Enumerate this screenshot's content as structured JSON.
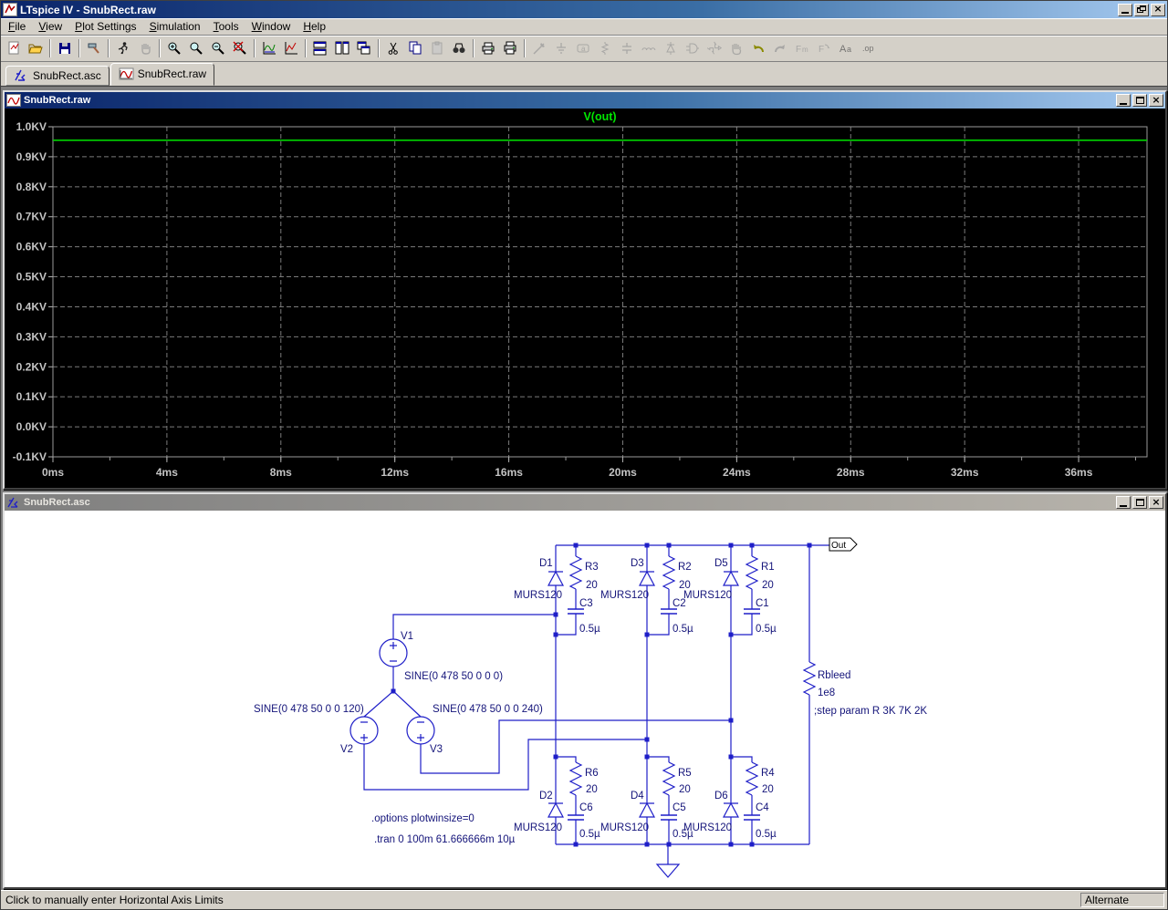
{
  "window": {
    "title": "LTspice IV - SnubRect.raw"
  },
  "menu": {
    "items": [
      "File",
      "View",
      "Plot Settings",
      "Simulation",
      "Tools",
      "Window",
      "Help"
    ]
  },
  "toolbar": {
    "buttons": [
      {
        "name": "new-schematic",
        "disabled": false
      },
      {
        "name": "open-file",
        "disabled": false
      },
      {
        "name": "save",
        "disabled": false
      },
      {
        "name": "control-panel",
        "disabled": false
      },
      {
        "name": "run-simulation",
        "disabled": false
      },
      {
        "name": "halt-simulation",
        "disabled": true
      },
      {
        "name": "zoom-in",
        "disabled": false
      },
      {
        "name": "zoom-to-rectangle",
        "disabled": false
      },
      {
        "name": "zoom-out",
        "disabled": false
      },
      {
        "name": "zoom-full-extents",
        "disabled": false
      },
      {
        "name": "autorange-y-axis",
        "disabled": false
      },
      {
        "name": "plot-settings",
        "disabled": false
      },
      {
        "name": "tile-horizontally",
        "disabled": false
      },
      {
        "name": "tile-vertically",
        "disabled": false
      },
      {
        "name": "cascade-windows",
        "disabled": false
      },
      {
        "name": "cut",
        "disabled": false
      },
      {
        "name": "copy",
        "disabled": false
      },
      {
        "name": "paste",
        "disabled": true
      },
      {
        "name": "find",
        "disabled": false
      },
      {
        "name": "print-preview",
        "disabled": false
      },
      {
        "name": "print",
        "disabled": false
      },
      {
        "name": "draw-wire",
        "disabled": true
      },
      {
        "name": "place-ground",
        "disabled": true
      },
      {
        "name": "place-label",
        "disabled": true
      },
      {
        "name": "place-resistor",
        "disabled": true
      },
      {
        "name": "place-capacitor",
        "disabled": true
      },
      {
        "name": "place-inductor",
        "disabled": true
      },
      {
        "name": "place-diode",
        "disabled": true
      },
      {
        "name": "place-component",
        "disabled": true
      },
      {
        "name": "move",
        "disabled": true
      },
      {
        "name": "drag",
        "disabled": true
      },
      {
        "name": "undo",
        "disabled": false
      },
      {
        "name": "redo",
        "disabled": true
      },
      {
        "name": "mirror",
        "disabled": true
      },
      {
        "name": "rotate",
        "disabled": true
      },
      {
        "name": "place-text",
        "disabled": true
      },
      {
        "name": "spice-directive",
        "disabled": true
      }
    ]
  },
  "tabs": [
    {
      "label": "SnubRect.asc",
      "icon": "schematic-icon",
      "active": false
    },
    {
      "label": "SnubRect.raw",
      "icon": "waveform-icon",
      "active": true
    }
  ],
  "plot_window": {
    "title": "SnubRect.raw"
  },
  "schematic_window": {
    "title": "SnubRect.asc"
  },
  "chart_data": {
    "type": "line",
    "title": "V(out)",
    "x_axis": {
      "unit": "ms",
      "range_ms": [
        0,
        38.4
      ],
      "major_tick_ms": 4,
      "minor_tick_ms": 2,
      "tick_labels": [
        "0ms",
        "4ms",
        "8ms",
        "12ms",
        "16ms",
        "20ms",
        "24ms",
        "28ms",
        "32ms",
        "36ms"
      ]
    },
    "y_axis": {
      "unit": "KV",
      "range_kv": [
        -0.1,
        1.0
      ],
      "tick_step_kv": 0.1,
      "tick_labels": [
        "1.0KV",
        "0.9KV",
        "0.8KV",
        "0.7KV",
        "0.6KV",
        "0.5KV",
        "0.4KV",
        "0.3KV",
        "0.2KV",
        "0.1KV",
        "0.0KV",
        "-0.1KV"
      ]
    },
    "grid": "dashed",
    "legend_position": "top-center",
    "series": [
      {
        "name": "V(out)",
        "color": "#00d400",
        "points": [
          {
            "t_ms": 0,
            "v_kv": 0.955
          },
          {
            "t_ms": 38.4,
            "v_kv": 0.955
          }
        ]
      }
    ]
  },
  "schematic": {
    "out_flag": "Out",
    "directives": {
      "options": ".options plotwinsize=0",
      "tran": ".tran 0 100m 61.666666m 10µ",
      "step": ";step param R 3K 7K 2K"
    },
    "sources": {
      "v1": {
        "name": "V1",
        "value": "SINE(0 478 50 0 0 0)"
      },
      "v2": {
        "name": "V2",
        "value": "SINE(0 478 50 0 0 120)"
      },
      "v3": {
        "name": "V3",
        "value": "SINE(0 478 50 0 0 240)"
      }
    },
    "rbleed": {
      "name": "Rbleed",
      "value": "1e8"
    },
    "top_bank": [
      {
        "diode": "D1",
        "model": "MURS120",
        "res": "R3",
        "res_val": "20",
        "cap": "C3",
        "cap_val": "0.5µ"
      },
      {
        "diode": "D3",
        "model": "MURS120",
        "res": "R2",
        "res_val": "20",
        "cap": "C2",
        "cap_val": "0.5µ"
      },
      {
        "diode": "D5",
        "model": "MURS120",
        "res": "R1",
        "res_val": "20",
        "cap": "C1",
        "cap_val": "0.5µ"
      }
    ],
    "bottom_bank": [
      {
        "diode": "D2",
        "model": "MURS120",
        "res": "R6",
        "res_val": "20",
        "cap": "C6",
        "cap_val": "0.5µ"
      },
      {
        "diode": "D4",
        "model": "MURS120",
        "res": "R5",
        "res_val": "20",
        "cap": "C5",
        "cap_val": "0.5µ"
      },
      {
        "diode": "D6",
        "model": "MURS120",
        "res": "R4",
        "res_val": "20",
        "cap": "C4",
        "cap_val": "0.5µ"
      }
    ]
  },
  "status_bar": {
    "message": "Click to manually enter Horizontal Axis Limits",
    "mode": "Alternate"
  },
  "colors": {
    "titlebar_active_start": "#0a246a",
    "titlebar_active_end": "#a6caf0",
    "chrome": "#d4d0c8",
    "plot_background": "#000000",
    "grid": "#7b7b7b",
    "axis_label": "#c4c4c4",
    "trace_green": "#00d400",
    "wire_blue": "#1e1ec8",
    "schematic_text": "#14147a"
  }
}
